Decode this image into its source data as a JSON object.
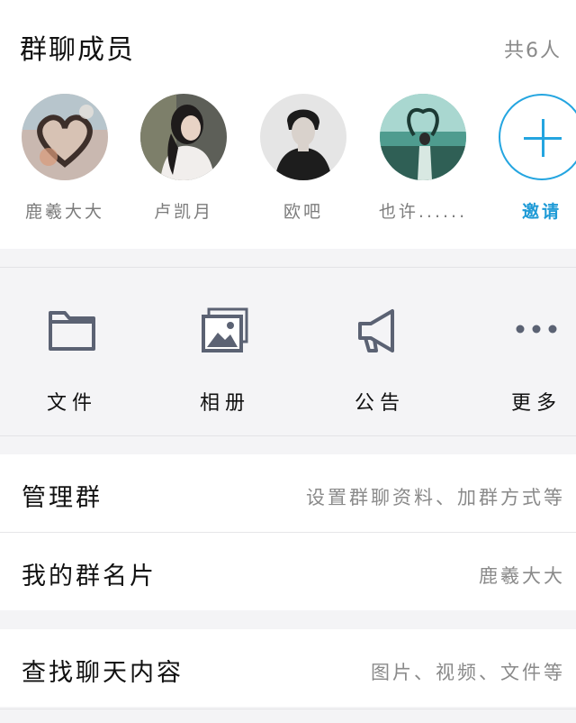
{
  "members": {
    "title": "群聊成员",
    "count": "共6人",
    "list": [
      {
        "name": "鹿羲大大",
        "avatar": "heart-photo-avatar"
      },
      {
        "name": "卢凯月",
        "avatar": "girl-portrait-avatar"
      },
      {
        "name": "欧吧",
        "avatar": "boy-portrait-avatar"
      },
      {
        "name": "也许......",
        "avatar": "seaside-photo-avatar"
      }
    ],
    "invite": {
      "label": "邀请",
      "icon": "plus-icon",
      "color": "#24a5e0"
    }
  },
  "tools": [
    {
      "label": "文件",
      "icon": "folder-icon"
    },
    {
      "label": "相册",
      "icon": "album-icon"
    },
    {
      "label": "公告",
      "icon": "megaphone-icon"
    },
    {
      "label": "更多",
      "icon": "more-dots-icon"
    }
  ],
  "rows": {
    "manage": {
      "label": "管理群",
      "value": "设置群聊资料、加群方式等"
    },
    "card": {
      "label": "我的群名片",
      "value": "鹿羲大大"
    },
    "search": {
      "label": "查找聊天内容",
      "value": "图片、视频、文件等"
    }
  },
  "colors": {
    "accent": "#24a5e0",
    "icon": "#5b6273",
    "secondary_text": "#8a8a8a",
    "background": "#f4f4f6"
  }
}
